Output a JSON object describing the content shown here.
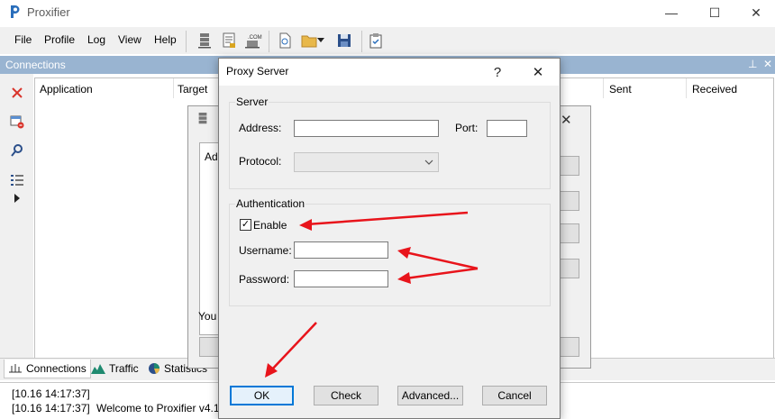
{
  "app": {
    "title": "Proxifier",
    "window_controls": {
      "minimize": "—",
      "maximize": "☐",
      "close": "✕"
    }
  },
  "menu": [
    "File",
    "Profile",
    "Log",
    "View",
    "Help"
  ],
  "toolbar": {
    "icons": [
      "proxy-servers-icon",
      "proxification-rules-icon",
      "name-resolution-icon",
      "new-profile-icon",
      "open-profile-icon",
      "save-profile-icon",
      "clipboard-icon"
    ]
  },
  "connections_panel": {
    "title": "Connections",
    "pin": "⊥",
    "close": "✕",
    "columns": [
      "Application",
      "Target",
      "Sent",
      "Received"
    ]
  },
  "bottom_tabs": [
    "Connections",
    "Traffic",
    "Statistics"
  ],
  "log": {
    "lines": [
      {
        "time": "[10.16 14:17:37]",
        "text": ""
      },
      {
        "time": "[10.16 14:17:37]",
        "text": "Welcome to Proxifier v4.1"
      }
    ]
  },
  "background_dialog": {
    "left_text": "Add",
    "bottom_text": "You c"
  },
  "dialog": {
    "title": "Proxy Server",
    "help": "?",
    "close": "✕",
    "server_group": {
      "label": "Server",
      "address_label": "Address:",
      "address_value": "",
      "port_label": "Port:",
      "port_value": "",
      "protocol_label": "Protocol:",
      "protocol_value": ""
    },
    "auth_group": {
      "label": "Authentication",
      "enable_label": "Enable",
      "enable_checked": true,
      "username_label": "Username:",
      "username_value": "",
      "password_label": "Password:",
      "password_value": ""
    },
    "buttons": {
      "ok": "OK",
      "check": "Check",
      "advanced": "Advanced...",
      "cancel": "Cancel"
    }
  },
  "colors": {
    "panel_header": "#99b4d1",
    "annotation_arrow": "#e8141b",
    "default_button_border": "#0078d7"
  }
}
